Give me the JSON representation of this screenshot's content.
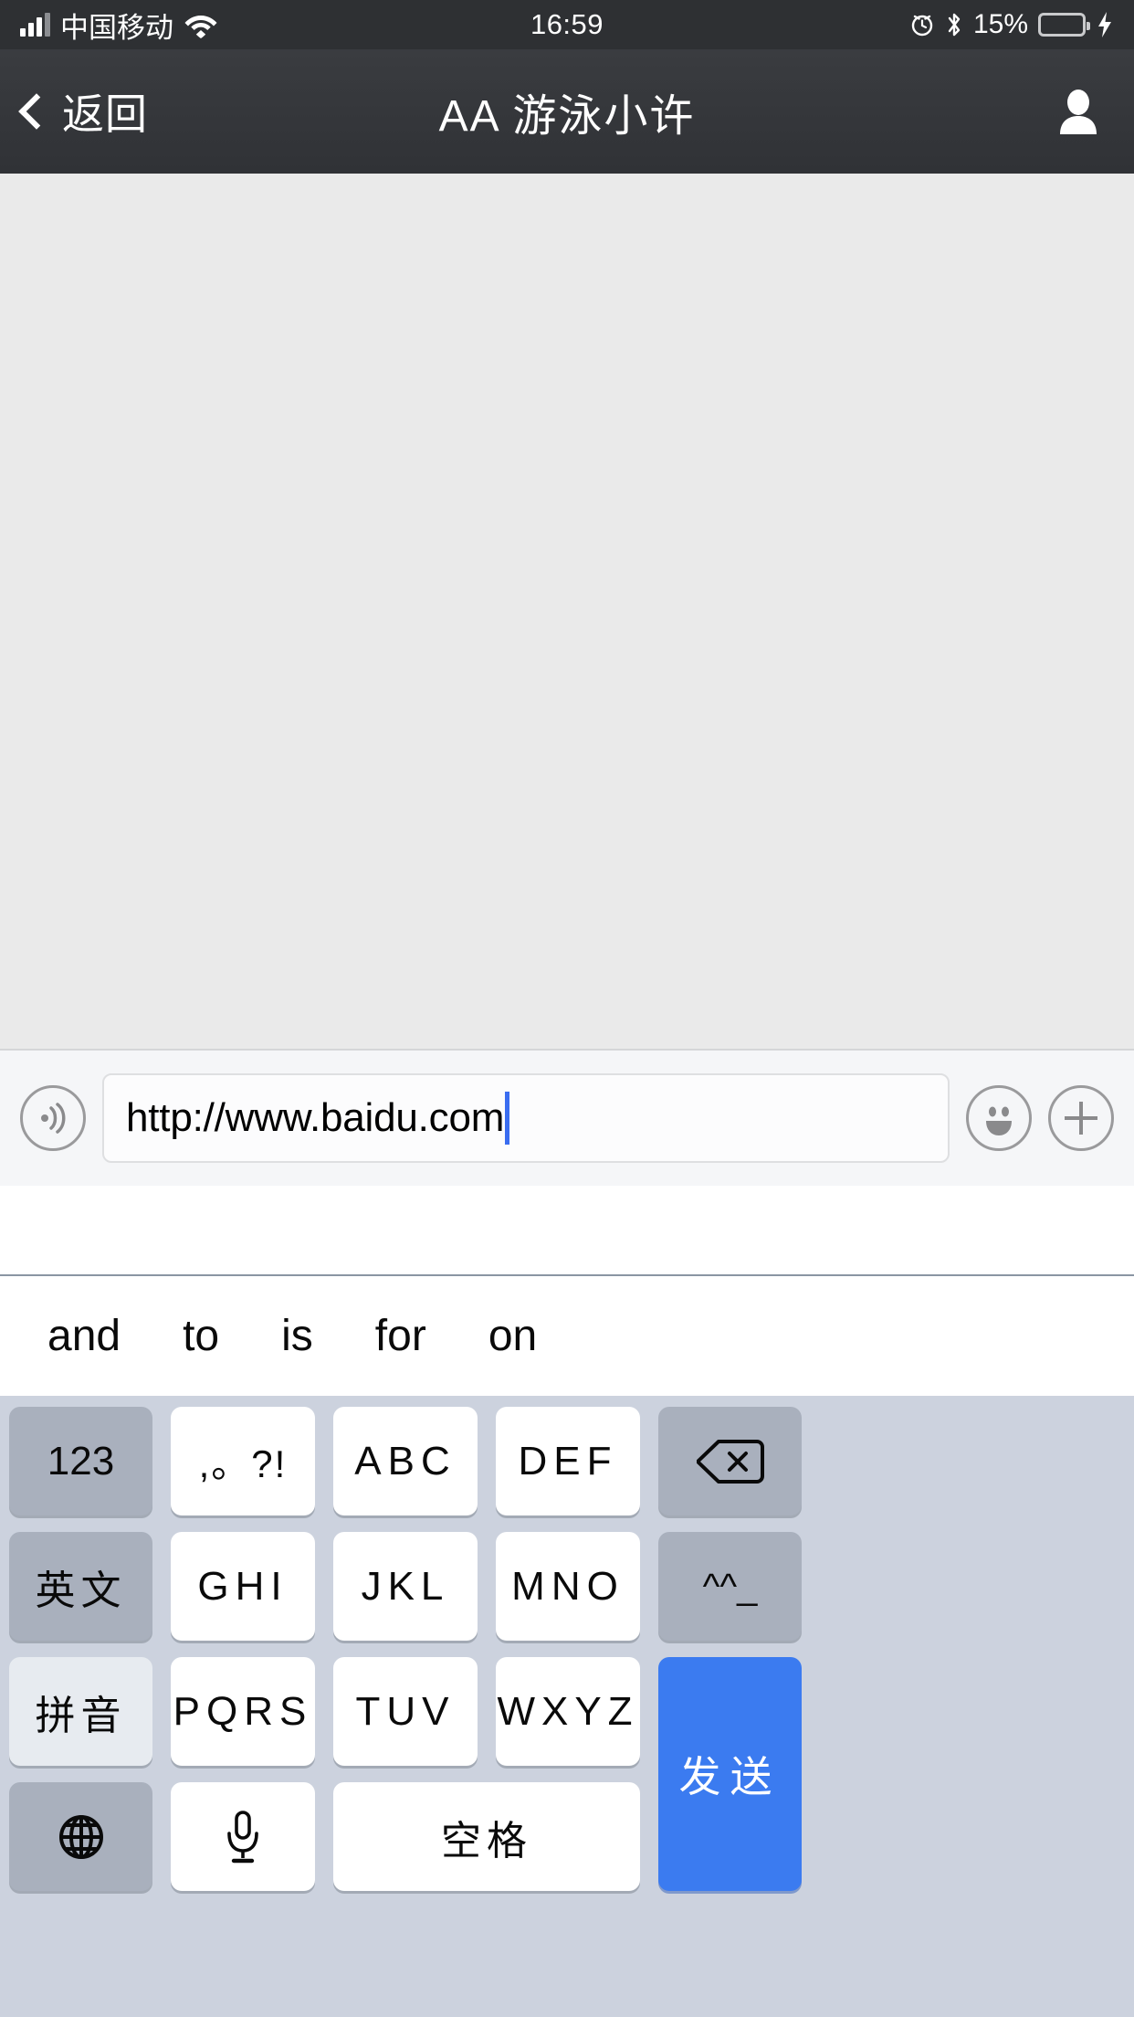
{
  "status_bar": {
    "carrier": "中国移动",
    "wifi_icon": "wifi-icon",
    "time": "16:59",
    "alarm_icon": "alarm-clock-icon",
    "bluetooth_icon": "bluetooth-icon",
    "battery_percent": "15%",
    "battery_level": 15,
    "battery_color": "#f4483b",
    "charging_icon": "lightning-bolt-icon"
  },
  "nav_bar": {
    "back_label": "返回",
    "title": "AA 游泳小许",
    "right_icon": "contact-person-icon",
    "background": "#303236"
  },
  "input_bar": {
    "voice_icon": "voice-sound-wave-icon",
    "text_value": "http://www.baidu.com",
    "placeholder": "",
    "emoji_icon": "smiley-face-icon",
    "plus_icon": "plus-icon",
    "caret_color": "#3a6df0"
  },
  "suggestions": {
    "items": [
      "and",
      "to",
      "is",
      "for",
      "on"
    ]
  },
  "keyboard": {
    "background": "#ccd2de",
    "send_color": "#3b7bf0",
    "rows": [
      [
        {
          "label": "123",
          "style": "gray",
          "name": "key-123",
          "kind": "text"
        },
        {
          "label": ",。?!",
          "style": "white",
          "name": "key-punctuation",
          "kind": "punct"
        },
        {
          "label": "ABC",
          "style": "white",
          "name": "key-abc",
          "kind": "latin"
        },
        {
          "label": "DEF",
          "style": "white",
          "name": "key-def",
          "kind": "latin"
        },
        {
          "label": "",
          "style": "gray",
          "name": "key-backspace",
          "kind": "icon-backspace"
        }
      ],
      [
        {
          "label": "英文",
          "style": "gray",
          "name": "key-english-mode",
          "kind": "cjk"
        },
        {
          "label": "GHI",
          "style": "white",
          "name": "key-ghi",
          "kind": "latin"
        },
        {
          "label": "JKL",
          "style": "white",
          "name": "key-jkl",
          "kind": "latin"
        },
        {
          "label": "MNO",
          "style": "white",
          "name": "key-mno",
          "kind": "latin"
        },
        {
          "label": "^^_",
          "style": "gray",
          "name": "key-emoticon",
          "kind": "emo"
        }
      ],
      [
        {
          "label": "拼音",
          "style": "pale",
          "name": "key-pinyin-mode",
          "kind": "cjk"
        },
        {
          "label": "PQRS",
          "style": "white",
          "name": "key-pqrs",
          "kind": "latin"
        },
        {
          "label": "TUV",
          "style": "white",
          "name": "key-tuv",
          "kind": "latin"
        },
        {
          "label": "WXYZ",
          "style": "white",
          "name": "key-wxyz",
          "kind": "latin"
        },
        {
          "label": "发送",
          "style": "blue",
          "name": "key-send",
          "kind": "send"
        }
      ],
      [
        {
          "label": "",
          "style": "gray",
          "name": "key-globe-language",
          "kind": "icon-globe"
        },
        {
          "label": "",
          "style": "white",
          "name": "key-microphone",
          "kind": "icon-mic"
        },
        {
          "label": "空格",
          "style": "white",
          "name": "key-space",
          "kind": "space"
        }
      ]
    ]
  }
}
